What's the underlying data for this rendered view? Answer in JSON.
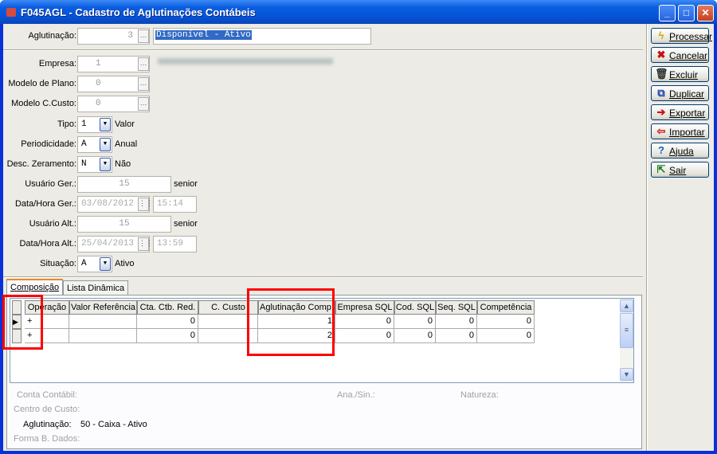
{
  "window": {
    "title": "F045AGL - Cadastro de Aglutinações Contábeis"
  },
  "form": {
    "aglutinacao": {
      "label": "Aglutinação:",
      "code": "3",
      "description": "Disponível - Ativo"
    },
    "empresa": {
      "label": "Empresa:",
      "value": "1"
    },
    "modelo_plano": {
      "label": "Modelo de Plano:",
      "value": "0"
    },
    "modelo_ccusto": {
      "label": "Modelo C.Custo:",
      "value": "0"
    },
    "tipo": {
      "label": "Tipo:",
      "value": "1",
      "text": "Valor"
    },
    "periodicidade": {
      "label": "Periodicidade:",
      "value": "A",
      "text": "Anual"
    },
    "desc_zeramento": {
      "label": "Desc. Zeramento:",
      "value": "N",
      "text": "Não"
    },
    "usuario_ger": {
      "label": "Usuário Ger.:",
      "value": "15",
      "text": "senior"
    },
    "data_hora_ger": {
      "label": "Data/Hora Ger.:",
      "date": "03/08/2012",
      "time": "15:14"
    },
    "usuario_alt": {
      "label": "Usuário Alt.:",
      "value": "15",
      "text": "senior"
    },
    "data_hora_alt": {
      "label": "Data/Hora Alt.:",
      "date": "25/04/2013",
      "time": "13:59"
    },
    "situacao": {
      "label": "Situação:",
      "value": "A",
      "text": "Ativo"
    }
  },
  "actions": [
    {
      "label": "Processar",
      "icon": "lightning-icon"
    },
    {
      "label": "Cancelar",
      "icon": "x-icon"
    },
    {
      "label": "Excluir",
      "icon": "trash-icon"
    },
    {
      "label": "Duplicar",
      "icon": "duplicate-icon"
    },
    {
      "label": "Exportar",
      "icon": "export-icon"
    },
    {
      "label": "Importar",
      "icon": "import-icon"
    },
    {
      "label": "Ajuda",
      "icon": "help-icon"
    },
    {
      "label": "Sair",
      "icon": "exit-icon"
    }
  ],
  "tabs": [
    "Composição",
    "Lista Dinâmica"
  ],
  "grid": {
    "columns": [
      "Operação",
      "Valor Referência",
      "Cta. Ctb. Red.",
      "C. Custo",
      "Aglutinação Comp.",
      "Empresa SQL",
      "Cod. SQL",
      "Seq. SQL",
      "Competência"
    ],
    "rows": [
      [
        "+",
        "",
        "0",
        "",
        "1",
        "0",
        "0",
        "0",
        "0"
      ],
      [
        "+",
        "",
        "0",
        "",
        "2",
        "0",
        "0",
        "0",
        "0"
      ]
    ]
  },
  "details": {
    "conta_contabil": "Conta Contábil:",
    "ana_sin": "Ana./Sin.:",
    "natureza": "Natureza:",
    "centro_custo": "Centro de Custo:",
    "aglutinacao_label": "Aglutinação:",
    "aglutinacao_value": "50 - Caixa - Ativo",
    "forma_dados": "Forma B. Dados:"
  }
}
